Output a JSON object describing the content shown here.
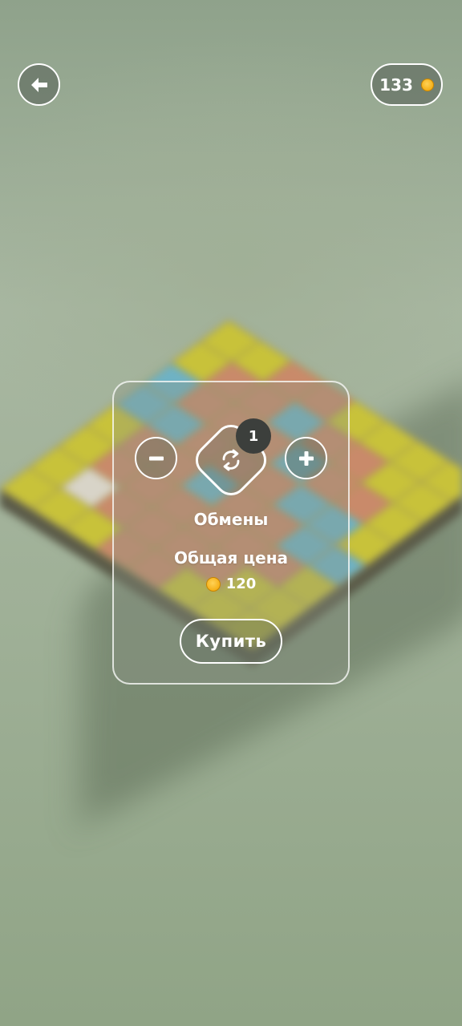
{
  "header": {
    "back_icon": "arrow-left-icon",
    "coins": "133",
    "coin_icon": "coin-icon"
  },
  "shop_panel": {
    "minus_icon": "minus-icon",
    "plus_icon": "plus-icon",
    "item_icon": "swap-icon",
    "quantity": "1",
    "item_name": "Обмены",
    "total_label": "Общая цена",
    "price": "120",
    "buy_label": "Купить"
  },
  "colors": {
    "background": "#8fa58a",
    "accent_white": "#ffffff",
    "badge": "#3c3f3c",
    "coin": "#f5b018"
  }
}
